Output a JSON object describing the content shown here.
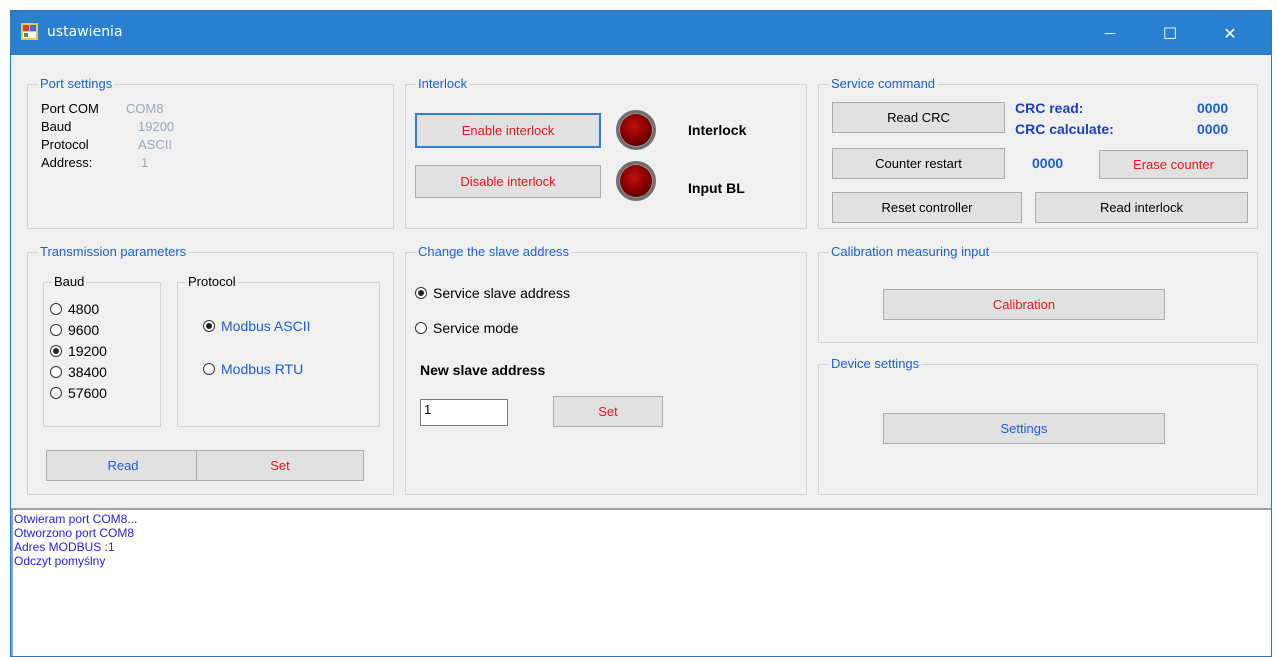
{
  "window": {
    "title": "ustawienia",
    "icon": "app-icon",
    "minimize_glyph": "—",
    "maximize_glyph": "☐",
    "close_glyph": "✕"
  },
  "port_settings": {
    "legend": "Port settings",
    "rows": [
      {
        "label": "Port COM",
        "value": "COM8"
      },
      {
        "label": "Baud",
        "value": "19200"
      },
      {
        "label": "Protocol",
        "value": "ASCII"
      },
      {
        "label": "Address:",
        "value": "1"
      }
    ]
  },
  "interlock": {
    "legend": "Interlock",
    "enable_label": "Enable interlock",
    "disable_label": "Disable interlock",
    "interlock_label": "Interlock",
    "input_bl_label": "Input BL"
  },
  "service_command": {
    "legend": "Service command",
    "read_crc_label": "Read CRC",
    "crc_read_label": "CRC read:",
    "crc_read_value": "0000",
    "crc_calculate_label": "CRC calculate:",
    "crc_calculate_value": "0000",
    "counter_restart_label": "Counter restart",
    "counter_value": "0000",
    "erase_counter_label": "Erase counter",
    "reset_controller_label": "Reset controller",
    "read_interlock_label": "Read interlock"
  },
  "transmission": {
    "legend": "Transmission parameters",
    "baud_legend": "Baud",
    "baud_options": [
      "4800",
      "9600",
      "19200",
      "38400",
      "57600"
    ],
    "baud_selected": "19200",
    "protocol_legend": "Protocol",
    "protocol_options": [
      "Modbus ASCII",
      "Modbus RTU"
    ],
    "protocol_selected": "Modbus ASCII",
    "read_label": "Read",
    "set_label": "Set"
  },
  "slave_address": {
    "legend": "Change the slave address",
    "option_service_slave": "Service slave address",
    "option_service_mode": "Service mode",
    "selected": "Service slave address",
    "new_label": "New slave address",
    "input_value": "1",
    "set_label": "Set"
  },
  "calibration": {
    "legend": "Calibration measuring input",
    "button_label": "Calibration"
  },
  "device_settings": {
    "legend": "Device settings",
    "button_label": "Settings"
  },
  "log": {
    "lines": [
      "Otwieram port COM8...",
      "Otworzono port COM8",
      "Adres MODBUS :1",
      "Odczyt pomyślny"
    ]
  },
  "colors": {
    "titlebar": "#2b7fd0",
    "legend_blue": "#1a5fd6",
    "button_red_text": "#e8141d",
    "log_text": "#1f1fe8",
    "led_red": "#8a0000"
  }
}
